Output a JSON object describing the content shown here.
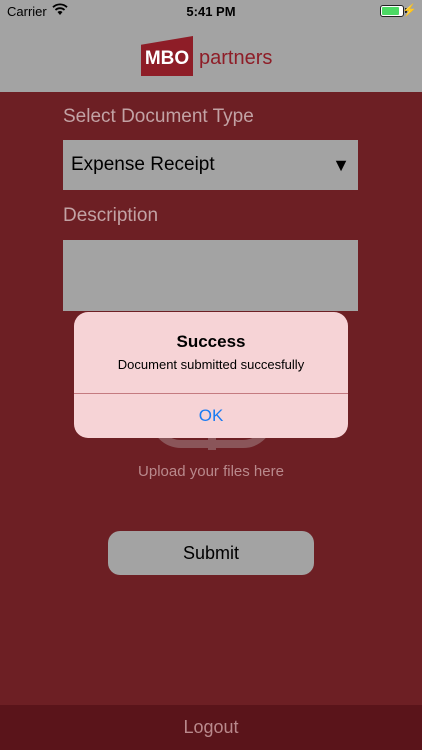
{
  "status_bar": {
    "carrier": "Carrier",
    "time": "5:41 PM",
    "battery_color": "#4cd964"
  },
  "header": {
    "logo_badge": "MBO",
    "logo_text": "partners",
    "brand_color": "#8e1d27"
  },
  "form": {
    "document_type_label": "Select Document Type",
    "document_type_value": "Expense Receipt",
    "description_label": "Description",
    "description_value": "",
    "upload_text": "Upload your files here",
    "submit_label": "Submit"
  },
  "footer": {
    "logout_label": "Logout"
  },
  "alert": {
    "title": "Success",
    "message": "Document submitted succesfully",
    "ok_label": "OK"
  },
  "icons": [
    "wifi-icon",
    "battery-icon",
    "charging-bolt-icon",
    "dropdown-caret-icon",
    "upload-cloud-icon"
  ]
}
